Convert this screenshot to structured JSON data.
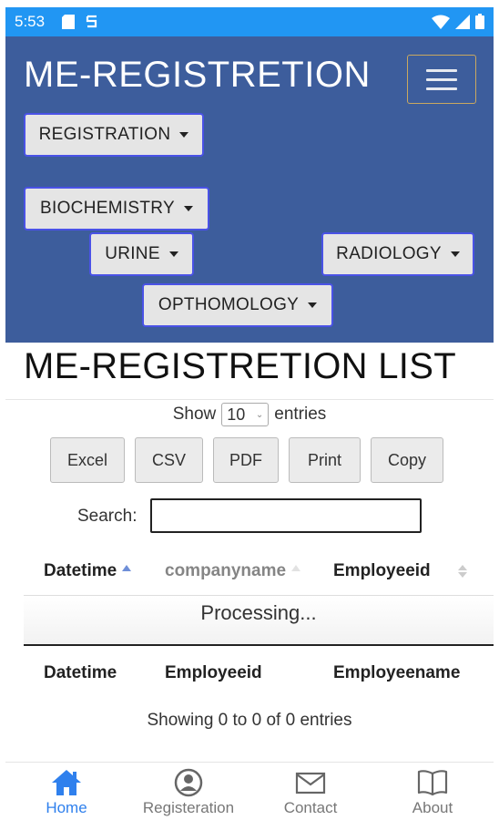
{
  "status_bar": {
    "time": "5:53"
  },
  "header": {
    "brand": "ME-REGISTRETION",
    "menus": {
      "registration": "REGISTRATION",
      "biochemistry": "BIOCHEMISTRY",
      "urine": "URINE",
      "radiology": "RADIOLOGY",
      "opthomology": "OPTHOMOLOGY"
    }
  },
  "page": {
    "title": "ME-REGISTRETION LIST"
  },
  "length_control": {
    "show_label": "Show",
    "value": "10",
    "entries_label": "entries"
  },
  "export_buttons": {
    "excel": "Excel",
    "csv": "CSV",
    "pdf": "PDF",
    "print": "Print",
    "copy": "Copy"
  },
  "search": {
    "label": "Search:",
    "value": ""
  },
  "table": {
    "header": [
      "Datetime",
      "companyname",
      "Employeeid"
    ],
    "processing": "Processing...",
    "footer": [
      "Datetime",
      "Employeeid",
      "Employeename"
    ],
    "info": "Showing 0 to 0 of 0 entries"
  },
  "bottom_nav": {
    "home": "Home",
    "registration": "Registeration",
    "contact": "Contact",
    "about": "About"
  },
  "colors": {
    "status_bar": "#2196f3",
    "header": "#3d5d9c",
    "active_nav": "#2f80ed"
  }
}
